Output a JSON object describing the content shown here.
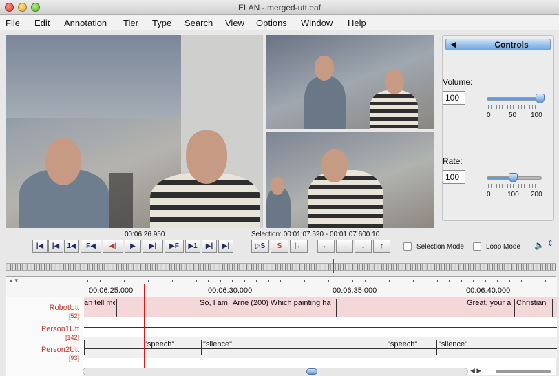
{
  "window": {
    "title": "ELAN - merged-utt.eaf"
  },
  "menu": [
    "File",
    "Edit",
    "Annotation",
    "Tier",
    "Type",
    "Search",
    "View",
    "Options",
    "Window",
    "Help"
  ],
  "controls": {
    "tab_arrow": "◀",
    "tab_label": "Controls",
    "volume_label": "Volume:",
    "volume_value": "100",
    "volume_level": 1.0,
    "volume_ticks": [
      "0",
      "50",
      "100"
    ],
    "rate_label": "Rate:",
    "rate_value": "100",
    "rate_level": 0.5,
    "rate_ticks": [
      "0",
      "100",
      "200"
    ]
  },
  "player": {
    "media_time": "00:06:26.950",
    "selection": "Selection: 00:01:07.590 - 00:01:07.600  10",
    "buttons": [
      "|◀",
      "|◀",
      "1◀",
      "F◀",
      "◀|",
      "▶",
      "▶|",
      "▶F",
      "▶1",
      "▶|",
      "▶|"
    ],
    "sel_buttons": [
      "▷S",
      "S",
      "|←"
    ],
    "arrow_buttons": [
      "←",
      "→",
      "↓",
      "↑"
    ],
    "selection_mode": "Selection Mode",
    "loop_mode": "Loop Mode"
  },
  "timeline": {
    "ruler": [
      "00:06:25.000",
      "00:06:30.000",
      "00:06:35.000",
      "00:06:40.000"
    ],
    "tiers": [
      {
        "name": "RobotUtt",
        "count": "[52]"
      },
      {
        "name": "Person1Utt",
        "count": "[142]"
      },
      {
        "name": "Person2Utt",
        "count": "[93]"
      }
    ],
    "robot_annotations": [
      "an tell me",
      "So, I am",
      "Arne (200) Which painting ha",
      "Great, your a",
      "Christian"
    ],
    "person2_annotations": [
      "\"speech\"",
      "\"silence\"",
      "\"speech\"",
      "\"silence\""
    ]
  },
  "colors": {
    "accent": "#5d9ce0",
    "crosshair": "#d21b1b",
    "tier_highlight": "#f3d7d9",
    "tier_name": "#c0392b"
  }
}
